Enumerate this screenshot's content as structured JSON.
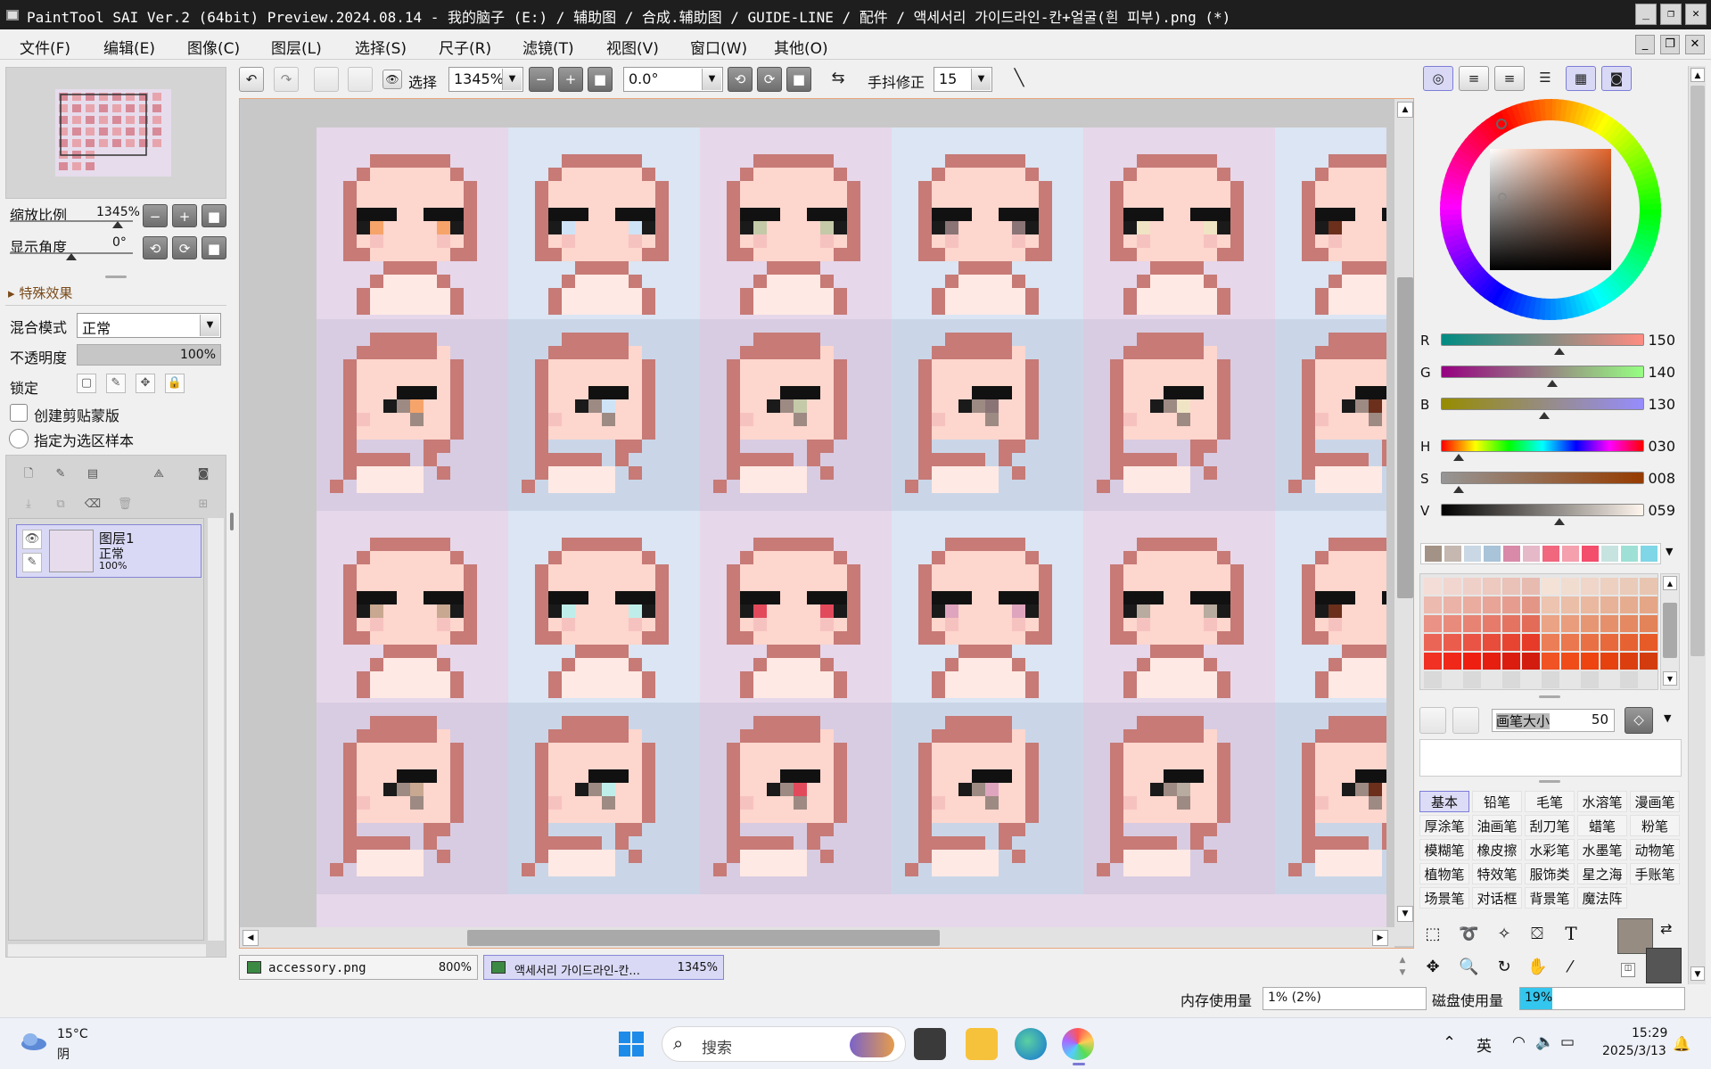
{
  "titlebar": {
    "title": "PaintTool SAI Ver.2 (64bit) Preview.2024.08.14 - 我的脑子 (E:) / 辅助图 / 合成.辅助图 / GUIDE-LINE / 配件 / 액세서리 가이드라인-칸+얼굴(흰 피부).png (*)"
  },
  "menu": [
    "文件(F)",
    "编辑(E)",
    "图像(C)",
    "图层(L)",
    "选择(S)",
    "尺子(R)",
    "滤镜(T)",
    "视图(V)",
    "窗口(W)",
    "其他(O)"
  ],
  "toolbar": {
    "select_label": "选择",
    "zoom_value": "1345%",
    "angle_value": "0.0°",
    "stabilizer_label": "手抖修正",
    "stabilizer_value": "15"
  },
  "navigator": {
    "zoom_label": "缩放比例",
    "zoom_value": "1345%",
    "angle_label": "显示角度",
    "angle_value": "0°"
  },
  "layer_props": {
    "effects_label": "特殊效果",
    "blend_label": "混合模式",
    "blend_value": "正常",
    "opacity_label": "不透明度",
    "opacity_value": "100%",
    "lock_label": "锁定",
    "clip_label": "创建剪贴蒙版",
    "sample_label": "指定为选区样本"
  },
  "layers": [
    {
      "name": "图层1",
      "mode": "正常",
      "opacity": "100%"
    }
  ],
  "doc_tabs": [
    {
      "name": "accessory.png",
      "zoom": "800%"
    },
    {
      "name": "액세서리 가이드라인-칸...",
      "zoom": "1345%"
    }
  ],
  "color": {
    "R": "150",
    "G": "140",
    "B": "130",
    "H": "030",
    "S": "008",
    "V": "059",
    "current": "#968c82",
    "secondary": "#555555"
  },
  "brush_size": {
    "label": "画笔大小",
    "value": "50"
  },
  "brush_groups": [
    [
      "基本",
      "铅笔",
      "毛笔",
      "水溶笔",
      "漫画笔"
    ],
    [
      "厚涂笔",
      "油画笔",
      "刮刀笔",
      "蜡笔",
      "粉笔"
    ],
    [
      "模糊笔",
      "橡皮擦",
      "水彩笔",
      "水墨笔",
      "动物笔"
    ],
    [
      "植物笔",
      "特效笔",
      "服饰类",
      "星之海",
      "手账笔"
    ],
    [
      "场景笔",
      "对话框",
      "背景笔",
      "魔法阵"
    ]
  ],
  "status": {
    "memory_label": "内存使用量",
    "memory_value": "1% (2%)",
    "disk_label": "磁盘使用量",
    "disk_value": "19%"
  },
  "taskbar": {
    "weather_temp": "15°C",
    "weather_desc": "阴",
    "search_placeholder": "搜索",
    "ime": "英",
    "time": "15:29",
    "date": "2025/3/13"
  },
  "swatches_top": [
    "#a39386",
    "#c4b8b0",
    "#c9d8e4",
    "#a9c3d8",
    "#d88aa8",
    "#e6b9c8",
    "#f0677e",
    "#f4a0ad",
    "#f34e6c",
    "#c7e3e0",
    "#9fe0d6",
    "#7fd6e6"
  ],
  "eye_colors": [
    "#f7a46a",
    "#cfe3f6",
    "#c4c9a8",
    "#8a7476",
    "#efe4c4",
    "#6b2f1c",
    "#f7a46a",
    "#cfe3f6",
    "#c4c9a8",
    "#8a7476",
    "#efe4c4",
    "#6b2f1c",
    "#c8a890",
    "#bfeeea",
    "#e24a5c",
    "#dfa5be",
    "#b8ab9f",
    "#6b2f1c",
    "#c8a890",
    "#bfeeea",
    "#e24a5c",
    "#dfa5be",
    "#b8ab9f",
    "#6b2f1c"
  ]
}
